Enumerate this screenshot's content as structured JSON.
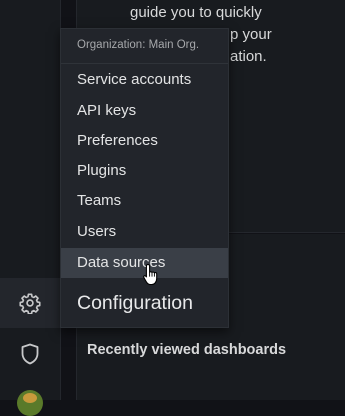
{
  "welcome": {
    "line1": "guide you to quickly",
    "line2_fragment": "p your",
    "line3_fragment": "ation."
  },
  "recent": {
    "title": "Recently viewed dashboards"
  },
  "menu": {
    "header": "Organization: Main Org.",
    "items": [
      {
        "label": "Service accounts"
      },
      {
        "label": "API keys"
      },
      {
        "label": "Preferences"
      },
      {
        "label": "Plugins"
      },
      {
        "label": "Teams"
      },
      {
        "label": "Users"
      },
      {
        "label": "Data sources",
        "hovered": true
      }
    ],
    "footer": "Configuration"
  },
  "sidebar": {
    "icons": [
      "gear-icon",
      "shield-icon",
      "user-avatar"
    ]
  },
  "colors": {
    "background": "#111217",
    "panel": "#181b1f",
    "menu": "#22252b",
    "hover": "#3a3f47",
    "text": "#d8d9da"
  }
}
